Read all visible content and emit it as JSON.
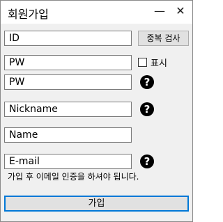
{
  "window": {
    "title": "회원가입",
    "minimize_glyph": "—",
    "close_glyph": "✕"
  },
  "form": {
    "id_value": "ID",
    "dup_check_label": "중복 검사",
    "pw_value": "PW",
    "show_label": "표시",
    "show_checked": false,
    "pw_confirm_value": "PW",
    "nickname_value": "Nickname",
    "name_value": "Name",
    "email_value": "E-mail",
    "email_note": "가입 후 이메일 인증을 하셔야 됩니다.",
    "help_glyph": "?",
    "submit_label": "가입"
  },
  "icons": [
    "minimize-icon",
    "close-icon",
    "help-icon"
  ]
}
